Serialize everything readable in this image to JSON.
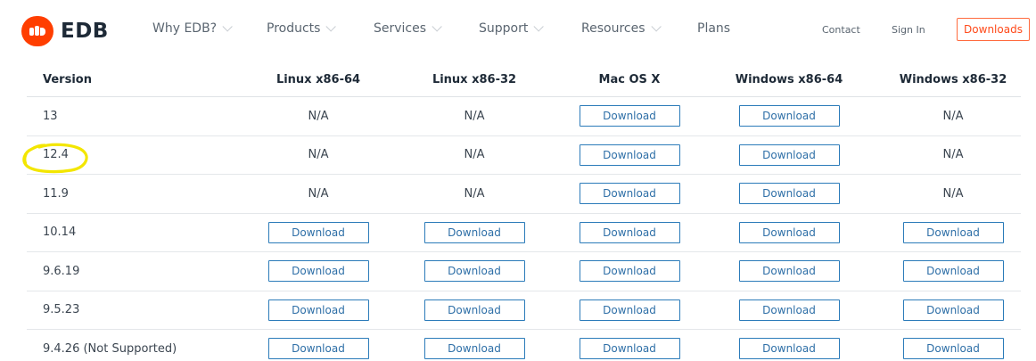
{
  "brand": {
    "name": "EDB",
    "accent": "#ff3e00"
  },
  "nav": {
    "items": [
      {
        "label": "Why EDB?"
      },
      {
        "label": "Products"
      },
      {
        "label": "Services"
      },
      {
        "label": "Support"
      },
      {
        "label": "Resources"
      },
      {
        "label": "Plans"
      }
    ],
    "contact": "Contact",
    "sign_in": "Sign In",
    "downloads": "Downloads"
  },
  "table": {
    "headers": [
      "Version",
      "Linux x86-64",
      "Linux x86-32",
      "Mac OS X",
      "Windows x86-64",
      "Windows x86-32"
    ],
    "rows": [
      {
        "version": "13",
        "cells": [
          "N/A",
          "N/A",
          "Download",
          "Download",
          "N/A"
        ]
      },
      {
        "version": "12.4",
        "cells": [
          "N/A",
          "N/A",
          "Download",
          "Download",
          "N/A"
        ]
      },
      {
        "version": "11.9",
        "cells": [
          "N/A",
          "N/A",
          "Download",
          "Download",
          "N/A"
        ]
      },
      {
        "version": "10.14",
        "cells": [
          "Download",
          "Download",
          "Download",
          "Download",
          "Download"
        ]
      },
      {
        "version": "9.6.19",
        "cells": [
          "Download",
          "Download",
          "Download",
          "Download",
          "Download"
        ]
      },
      {
        "version": "9.5.23",
        "cells": [
          "Download",
          "Download",
          "Download",
          "Download",
          "Download"
        ]
      },
      {
        "version": "9.4.26 (Not Supported)",
        "cells": [
          "Download",
          "Download",
          "Download",
          "Download",
          "Download"
        ]
      }
    ]
  },
  "annotation": {
    "highlight_color": "#f3e600"
  }
}
